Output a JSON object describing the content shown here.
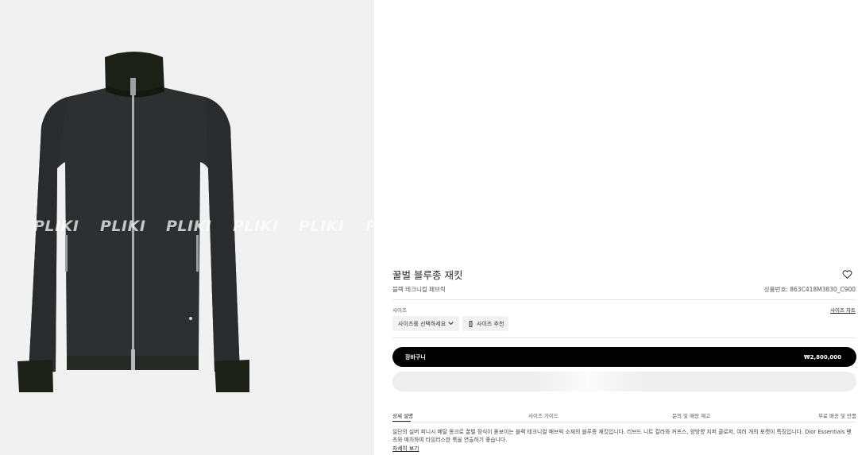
{
  "gallery": {
    "watermark": "PLIKI",
    "watermark_repeats": [
      "PLIKI",
      "PLIKI",
      "PLIKI",
      "PLIKI",
      "PLIKI",
      "PLIKI"
    ],
    "image_alt": "black zip-up jacket"
  },
  "product": {
    "title": "꿀벌 블루종 재킷",
    "subtitle": "블랙 테크니컬 패브릭",
    "sku": "상품번호: 863C418M3830_C900",
    "wishlist_icon": "heart-outline-icon"
  },
  "size": {
    "label": "사이즈",
    "chart_link": "사이즈 차트",
    "select_placeholder": "사이즈를 선택하세요",
    "recommend_label": "사이즈 추천",
    "recommend_icon_glyph": "⛶"
  },
  "cart": {
    "label": "장바구니",
    "price": "₩2,800,000"
  },
  "tabs": [
    {
      "label": "상세 설명"
    },
    {
      "label": "사이즈 가이드"
    },
    {
      "label": "문의 및 매장 재고"
    },
    {
      "label": "무료 배송 및 반품"
    }
  ],
  "description": {
    "text": "일단의 실버 피니시 메탈 몽크로 꿀벌 장식이 돋보이는 블랙 테크니컬 패브릭 소재의 블루종 재킷입니다. 리브드 니트 칼라와 커프스, 양방향 지퍼 클로저, 여러 개의 포켓이 특징입니다. Dior Essentials 팬츠와 매치하여 타임리스한 룩을 연출하기 좋습니다.",
    "more_link": "자세히 보기"
  },
  "colors": {
    "jacket": "#2f3032",
    "knit": "#1d2017",
    "gallery_bg": "#f1f1f1",
    "button": "#000000"
  }
}
